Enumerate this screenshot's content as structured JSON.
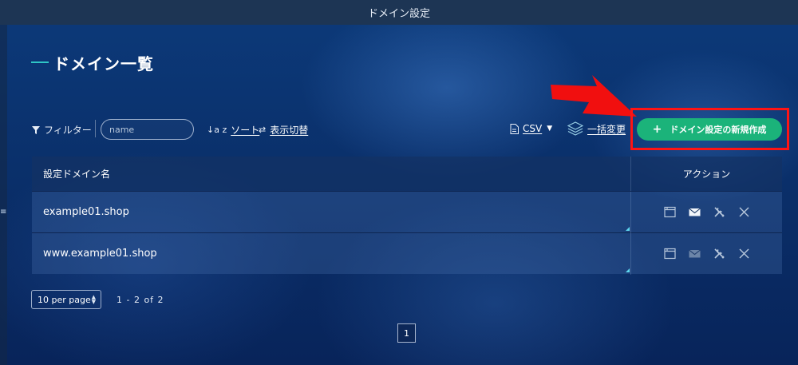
{
  "window": {
    "title": "ドメイン設定"
  },
  "page": {
    "heading": "ドメイン一覧"
  },
  "toolbar": {
    "filter_label": "フィルター",
    "name_placeholder": "name",
    "sort_label": "ソート",
    "sort_icon": "↓a z",
    "toggle_label": "表示切替",
    "csv_label": "CSV",
    "bulk_label": "一括変更",
    "new_button_label": "ドメイン設定の新規作成",
    "new_button_icon": "+"
  },
  "table": {
    "columns": [
      "設定ドメイン名",
      "アクション"
    ],
    "rows": [
      {
        "domain": "example01.shop",
        "mail_enabled": true
      },
      {
        "domain": "www.example01.shop",
        "mail_enabled": false
      }
    ],
    "action_icons": [
      "window-icon",
      "mail-icon",
      "tools-icon",
      "delete-icon"
    ]
  },
  "pagination": {
    "per_page": "10 per page",
    "range": "1 - 2 of 2",
    "current_page": "1"
  },
  "colors": {
    "accent": "#1bb37a",
    "highlight": "#ff1414",
    "heading_bar": "#2fc6c6"
  }
}
